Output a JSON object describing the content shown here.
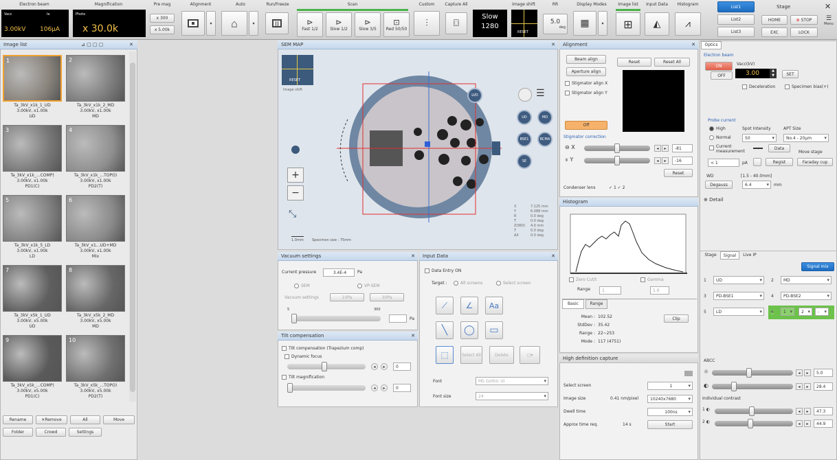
{
  "toolbar": {
    "electron_beam": {
      "title": "Electron beam",
      "vacc_label": "Vacc",
      "ie_label": "Ie",
      "vacc": "3.00kV",
      "ie": "106μA"
    },
    "magnification": {
      "title": "Magnification",
      "photo_label": "Photo",
      "value": "x 30.0k"
    },
    "pre_mag": {
      "title": "Pre mag",
      "b1": "x 300",
      "b2": "x 5.00k"
    },
    "alignment": "Alignment",
    "auto": "Auto",
    "run_freeze": "Run/Freeze",
    "scan": "Scan",
    "scan_buttons": [
      "Fast 1/2",
      "Slow 1/2",
      "Slow 3/5",
      "Red 50/50"
    ],
    "custom": "Custom",
    "capture_all": "Capture All",
    "slow_label": "Slow",
    "slow_value": "1280",
    "image_shift": "Image shift",
    "reset": "RESET",
    "rr": "RR",
    "rr_value": "5.0",
    "rr_unit": "deg",
    "display_modes": "Display Modes",
    "image_list": "Image list",
    "input_data": "Input Data",
    "histogram": "Histogram",
    "lists": [
      "List1",
      "List2",
      "List3"
    ],
    "stage_title": "Stage",
    "home": "HOME",
    "stop": "STOP",
    "exc": "EXC",
    "lock": "LOCK",
    "menu": "Menu"
  },
  "image_list": {
    "title": "Image list",
    "items": [
      {
        "num": "1",
        "name": "Ta_3kV_x1k_1_UD",
        "info": "3.00kV, x1.00k",
        "sig": "UD",
        "c": "#8a847c"
      },
      {
        "num": "2",
        "name": "Ta_3kV_x1k_2_MD",
        "info": "3.00kV, x1.00k",
        "sig": "MD",
        "c": "#7d7d7d"
      },
      {
        "num": "3",
        "name": "Ta_3kV_x1k_...COMP)",
        "info": "3.00kV, x1.00k",
        "sig": "PD1(C)",
        "c": "#787878"
      },
      {
        "num": "4",
        "name": "Ta_3kV_x1k_...TOPO)",
        "info": "3.00kV, x1.00k",
        "sig": "PD2(T)",
        "c": "#8f8f8f"
      },
      {
        "num": "5",
        "name": "Ta_3kV_x1k_5_LD",
        "info": "3.00kV, x1.00k",
        "sig": "LD",
        "c": "#828282"
      },
      {
        "num": "6",
        "name": "Ta_3kV_x1...UD+MD",
        "info": "3.00kV, x1.00k",
        "sig": "Mix",
        "c": "#8a8a8a"
      },
      {
        "num": "7",
        "name": "Ta_3kV_x5k_1_UD",
        "info": "3.00kV, x5.00k",
        "sig": "UD",
        "c": "#5f5f5f"
      },
      {
        "num": "8",
        "name": "Ta_3kV_x5k_2_MD",
        "info": "3.00kV, x5.00k",
        "sig": "MD",
        "c": "#676767"
      },
      {
        "num": "9",
        "name": "Ta_3kV_x5k_...COMP)",
        "info": "3.00kV, x5.00k",
        "sig": "PD1(C)",
        "c": "#5a5a5a"
      },
      {
        "num": "10",
        "name": "Ta_3kV_x5k_...TOPO)",
        "info": "3.00kV, x5.00k",
        "sig": "PD2(T)",
        "c": "#707070"
      }
    ],
    "buttons": [
      "Rename",
      "Remove",
      "All",
      "Move",
      "Folder",
      "Crowd",
      "Settings"
    ]
  },
  "sem_map": {
    "title": "SEM MAP",
    "reset": "RESET",
    "image_shift": "Image shift",
    "scale": "1.0mm",
    "specimen_size": "Specimen size : 75mm",
    "buttons": [
      "LVD",
      "UD",
      "MD",
      "BSE1",
      "BCMA",
      "SE"
    ],
    "coords": [
      [
        "X",
        "7.125 mm"
      ],
      [
        "Y",
        "6.088 mm"
      ],
      [
        "R",
        "0.0 deg"
      ],
      [
        "T",
        "0.0 deg"
      ],
      [
        "Z(WD)",
        "4.0 mm"
      ],
      [
        "T",
        "0.0 deg"
      ],
      [
        "ΔX",
        "0.0 deg"
      ]
    ]
  },
  "alignment": {
    "title": "Alignment",
    "beam_align": "Beam align",
    "aperture_align": "Aperture align",
    "stig_x": "Stigmator align X",
    "stig_y": "Stigmator align Y",
    "reset": "Reset",
    "reset_all": "Reset All",
    "off": "Off",
    "stig_corr": "Stigmator correction",
    "x_val": "-81",
    "y_val": "-16",
    "reset2": "Reset",
    "condenser": "Condenser lens",
    "c1": "1",
    "c2": "2"
  },
  "histogram": {
    "title": "Histogram",
    "zero_cut": "Zero Cut/t",
    "gamma": "Gamma",
    "range": "Range",
    "range_val": "1",
    "gamma_val": "1.0",
    "tabs": [
      "Basic",
      "Range"
    ],
    "stats": [
      [
        "Mean :",
        "102.52"
      ],
      [
        "StdDev :",
        "35.42"
      ],
      [
        "Range :",
        "22~253"
      ],
      [
        "Mode :",
        "117 (4751)"
      ]
    ],
    "clip": "Clip"
  },
  "hd_capture": {
    "title": "High definition capture",
    "select_screen": "Select screen",
    "select_val": "1",
    "image_size": "Image size",
    "size_info": "0.41 nm/pixel",
    "size_val": "10240x7680",
    "dwell": "Dwell time",
    "dwell_val": "100ns",
    "approx": "Approx time req.",
    "approx_val": "14 s",
    "start": "Start"
  },
  "vacuum": {
    "title": "Vacuum settings",
    "current_pressure": "Current pressure",
    "pressure": "3.4E-4",
    "unit": "Pa",
    "sem": "SEM",
    "vp_sem": "VP-SEM",
    "vac_settings": "Vacuum settings",
    "b1": "10Pa",
    "b2": "30Pa",
    "min": "5",
    "max": "300",
    "pa": "Pa"
  },
  "tilt": {
    "title": "Tilt compensation",
    "tc": "Tilt compensation (Trapezium comp)",
    "dyn": "Dynamic focus",
    "tilt_mag": "Tilt magnification",
    "v1": "0",
    "v2": "0"
  },
  "input_data": {
    "title": "Input Data",
    "entry_on": "Data Entry ON",
    "target": "Target :",
    "all_screens": "All screens",
    "select_screen": "Select screen",
    "select_all": "Select All",
    "delete": "Delete",
    "font": "Font",
    "font_val": "MS Gothic UI",
    "font_size": "Font size",
    "font_size_val": "24"
  },
  "optics": {
    "tab": "Optics",
    "eb": "Electron beam",
    "on": "ON",
    "off": "OFF",
    "vacc": "Vacc(kV)",
    "vacc_val": "3.00",
    "set": "SET",
    "decel": "Deceleration",
    "spec_bias": "Specimen bias(+)",
    "probe": "Probe current",
    "high": "High",
    "normal": "Normal",
    "spot": "Spot Intensity",
    "spot_val": "50",
    "apt": "APT Size",
    "apt_val": "No.4 - 20μm",
    "cur_meas": "Current measurement",
    "data": "Data",
    "move_stage": "Move stage",
    "meas_val": "< 1",
    "pa": "pA",
    "regist": "Regist",
    "faraday": "Faraday cup",
    "wd": "WD",
    "wd_range": "[1.5 - 40.0mm]",
    "degauss": "Degauss",
    "wd_val": "6.4",
    "mm": "mm",
    "detail": "Detail"
  },
  "signal": {
    "tabs": [
      "Stage",
      "Signal",
      "Live IP"
    ],
    "mix": "Signal mix",
    "rows": [
      [
        "1",
        "UD",
        "2",
        "MD"
      ],
      [
        "3",
        "PD-BSE1",
        "4",
        "PD-BSE2"
      ],
      [
        "5",
        "LD",
        "6",
        "1"
      ]
    ],
    "mix_vals": [
      "2",
      "-"
    ]
  },
  "abcc": {
    "title": "ABCC",
    "v1": "5.0",
    "v2": "28.4",
    "indiv": "Individual contrast",
    "c1": "47.3",
    "c2": "44.9"
  }
}
